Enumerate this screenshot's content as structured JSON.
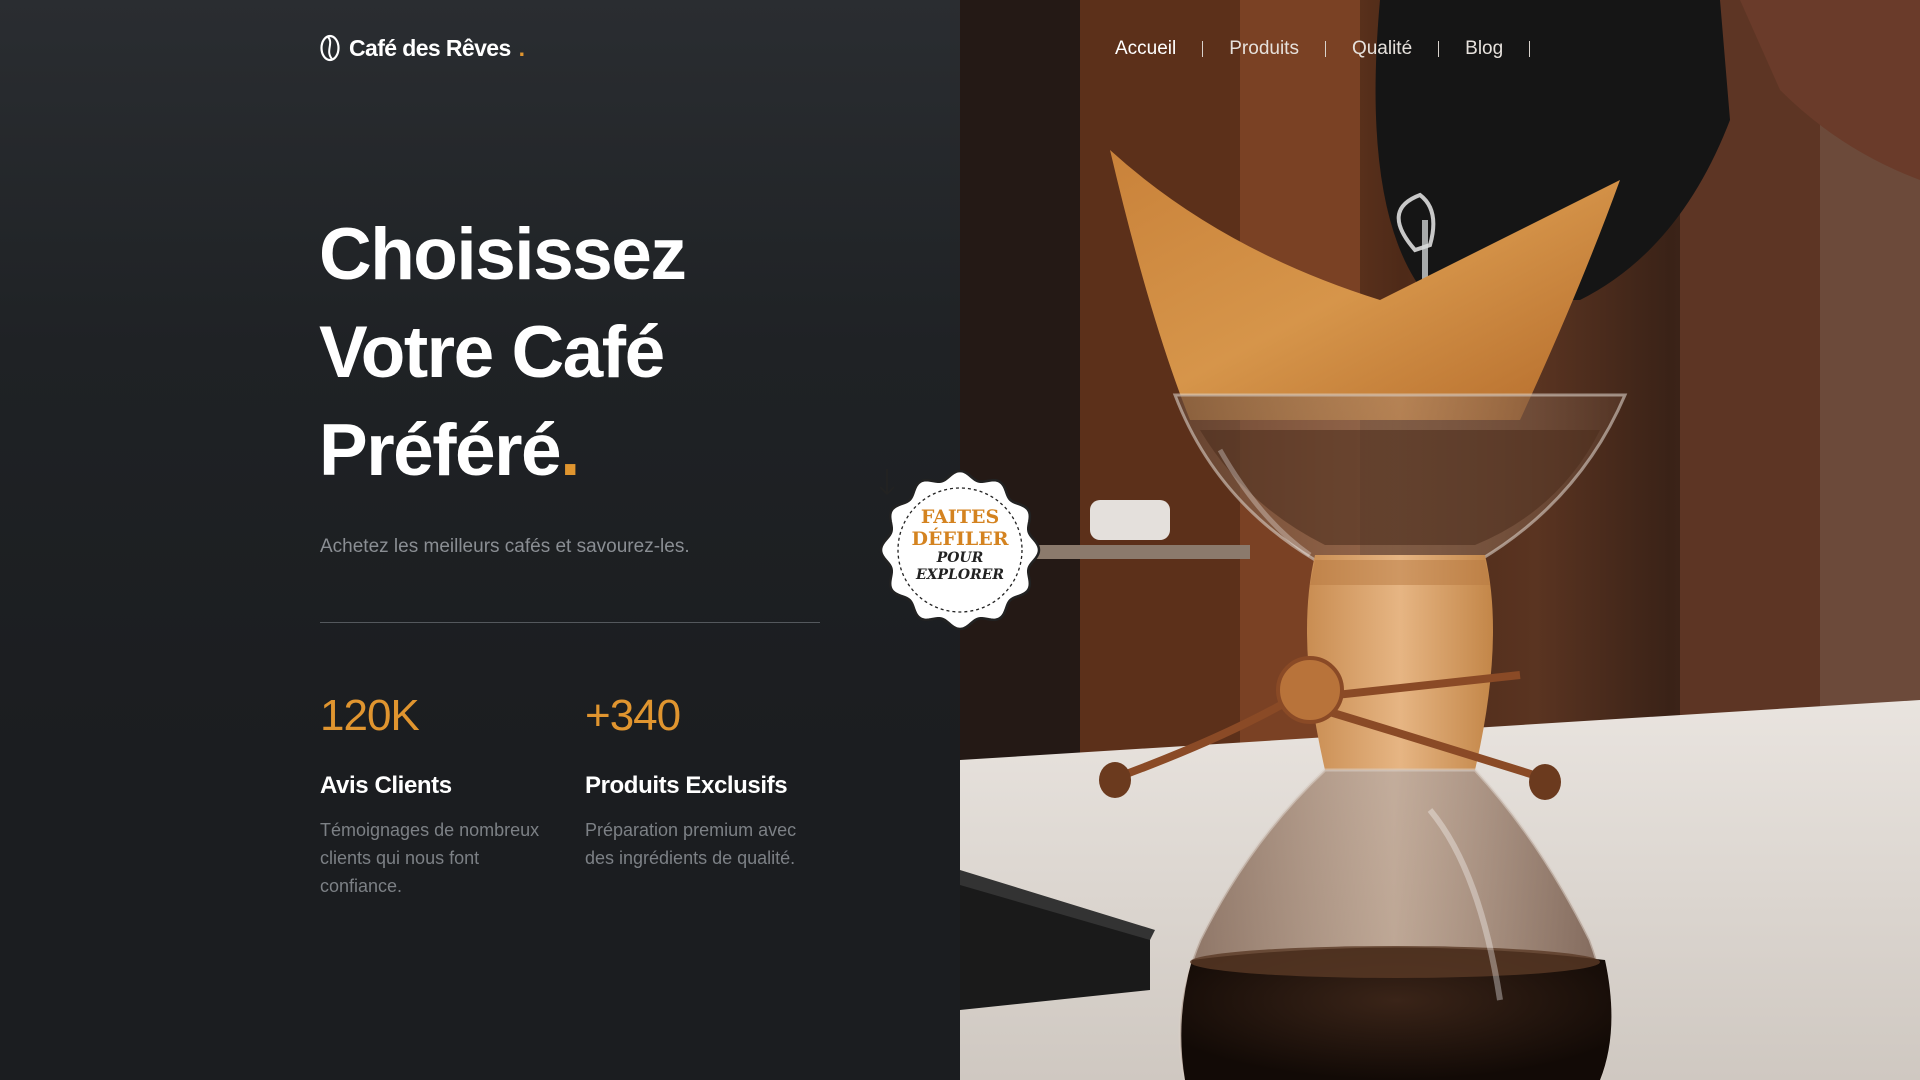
{
  "brand": {
    "name": "Café des Rêves",
    "dot": ".",
    "icon": "coffee-bean-icon"
  },
  "nav": {
    "items": [
      {
        "label": "Accueil",
        "active": true
      },
      {
        "label": "Produits",
        "active": false
      },
      {
        "label": "Qualité",
        "active": false
      },
      {
        "label": "Blog",
        "active": false
      }
    ]
  },
  "hero": {
    "line1": "Choisissez",
    "line2": "Votre Café",
    "line3": "Préféré",
    "dot": ".",
    "subtitle": "Achetez les meilleurs cafés et savourez-les."
  },
  "stats": [
    {
      "number": "120K",
      "title": "Avis Clients",
      "desc": "Témoignages de nombreux clients qui nous font confiance."
    },
    {
      "number": "+340",
      "title": "Produits Exclusifs",
      "desc": "Préparation premium avec des ingrédients de qualité."
    }
  ],
  "badge": {
    "line1": "FAITES",
    "line2": "DÉFILER",
    "line3": "POUR",
    "line4": "EXPLORER",
    "icon": "arrow-down-icon"
  },
  "colors": {
    "accent": "#e0952f",
    "background": "#1b1d20",
    "text": "#ffffff",
    "muted": "#8a8e93"
  },
  "hero_image": {
    "icon": "chemex-pour-over-photo"
  }
}
